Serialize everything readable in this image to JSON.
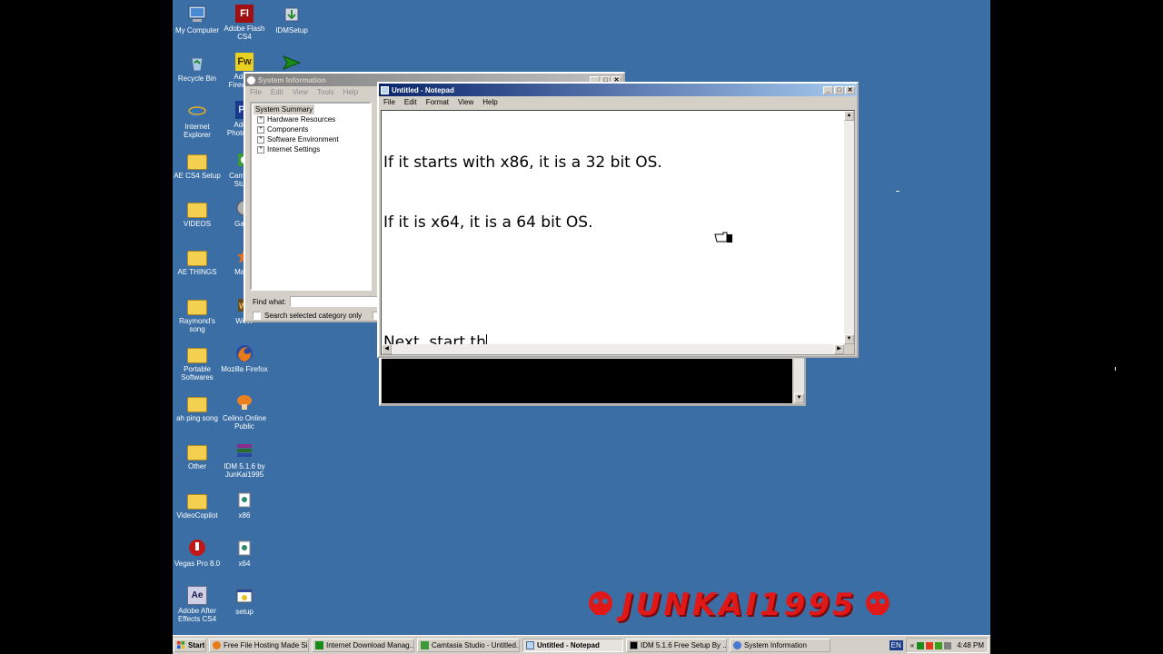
{
  "desktop_icons": [
    {
      "label": "My Computer",
      "icon": "my-computer-icon"
    },
    {
      "label": "Recycle Bin",
      "icon": "recycle-bin-icon"
    },
    {
      "label": "Internet Explorer",
      "icon": "internet-explorer-icon"
    },
    {
      "label": "AE CS4 Setup",
      "icon": "folder-icon"
    },
    {
      "label": "VIDEOS",
      "icon": "folder-icon"
    },
    {
      "label": "AE THINGS",
      "icon": "folder-icon"
    },
    {
      "label": "Raymond's song",
      "icon": "folder-icon"
    },
    {
      "label": "Portable Softwares",
      "icon": "folder-icon"
    },
    {
      "label": "ah ping song",
      "icon": "folder-icon"
    },
    {
      "label": "Other",
      "icon": "folder-icon"
    },
    {
      "label": "VideoCopilot",
      "icon": "folder-icon"
    },
    {
      "label": "Vegas Pro 8.0",
      "icon": "vegas-icon"
    },
    {
      "label": "Adobe After Effects CS4",
      "icon": "after-effects-icon"
    },
    {
      "label": "Adobe Flash CS4",
      "icon": "flash-icon"
    },
    {
      "label": "Adobe Fireworks",
      "icon": "fireworks-icon"
    },
    {
      "label": "Adobe Photoshop",
      "icon": "photoshop-icon"
    },
    {
      "label": "Camtasia Studio",
      "icon": "camtasia-icon"
    },
    {
      "label": "Game",
      "icon": "game-icon"
    },
    {
      "label": "Maple",
      "icon": "maple-icon"
    },
    {
      "label": "WoW",
      "icon": "wow-icon"
    },
    {
      "label": "Mozilla Firefox",
      "icon": "firefox-icon"
    },
    {
      "label": "Celino Online Public",
      "icon": "celino-icon"
    },
    {
      "label": "IDM 5.1.6 by JunKai1995",
      "icon": "winrar-icon"
    },
    {
      "label": "x86",
      "icon": "setup-icon"
    },
    {
      "label": "x64",
      "icon": "setup-icon"
    },
    {
      "label": "setup",
      "icon": "setup-icon"
    },
    {
      "label": "IDMSetup",
      "icon": "idm-setup-icon"
    }
  ],
  "sysinfo": {
    "title": "System Information",
    "menu": [
      "File",
      "Edit",
      "View",
      "Tools",
      "Help"
    ],
    "tree_root": "System Summary",
    "tree_items": [
      "Hardware Resources",
      "Components",
      "Software Environment",
      "Internet Settings"
    ],
    "find_label": "Find what:",
    "search_selected_label": "Search selected category only"
  },
  "notepad": {
    "title": "Untitled - Notepad",
    "menu": [
      "File",
      "Edit",
      "Format",
      "View",
      "Help"
    ],
    "lines": [
      "If it starts with x86, it is a 32 bit OS.",
      "If it is x64, it is a 64 bit OS.",
      "",
      "Next, start th"
    ]
  },
  "watermark": "JUNKAI1995",
  "taskbar": {
    "start_label": "Start",
    "items": [
      {
        "label": "Free File Hosting Made Si...",
        "icon": "firefox-icon",
        "active": false
      },
      {
        "label": "Internet Download Manag...",
        "icon": "idm-icon",
        "active": false
      },
      {
        "label": "Camtasia Studio - Untitled...",
        "icon": "camtasia-icon",
        "active": false
      },
      {
        "label": "Untitled - Notepad",
        "icon": "notepad-icon",
        "active": true
      },
      {
        "label": "IDM 5.1.6 Free Setup By ...",
        "icon": "cmd-icon",
        "active": false
      },
      {
        "label": "System Information",
        "icon": "sysinfo-icon",
        "active": false
      }
    ],
    "lang": "EN",
    "expand_label": "«",
    "clock": "4:48 PM"
  }
}
